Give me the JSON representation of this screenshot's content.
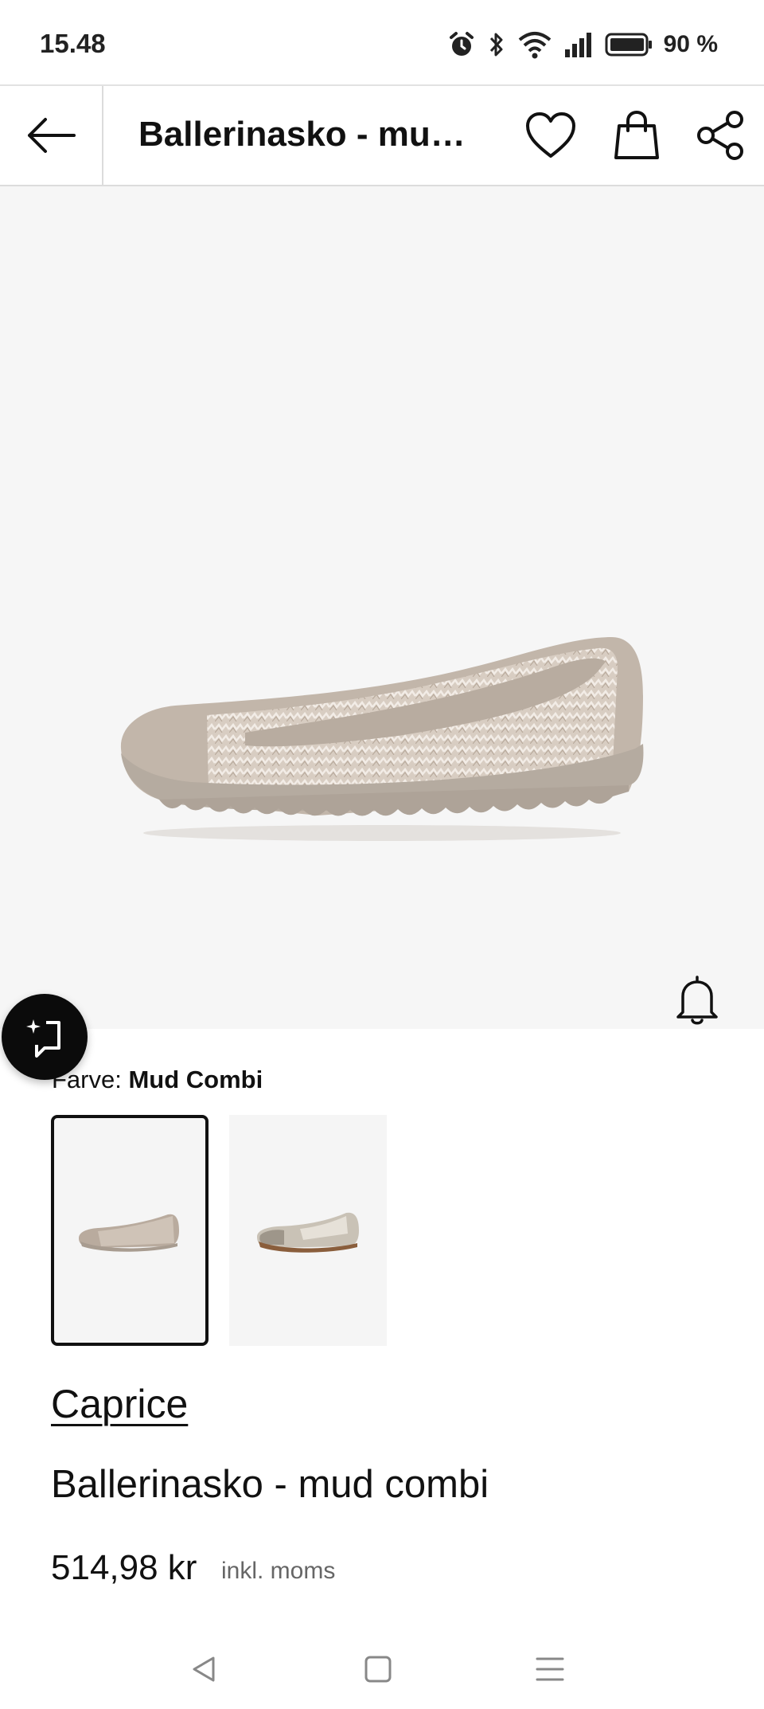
{
  "status_bar": {
    "time": "15.48",
    "battery": "90 %",
    "icons": [
      "alarm-icon",
      "bluetooth-icon",
      "wifi-icon",
      "signal-icon",
      "battery-icon"
    ]
  },
  "app_bar": {
    "title": "Ballerinasko - mud...",
    "icons": [
      "back-arrow-icon",
      "heart-icon",
      "shopping-bag-icon",
      "share-icon"
    ]
  },
  "product": {
    "color_label": "Farve: ",
    "color_value": "Mud Combi",
    "swatches": [
      {
        "name": "mud-combi",
        "selected": true
      },
      {
        "name": "metallic",
        "selected": false
      }
    ],
    "brand": "Caprice",
    "name": "Ballerinasko - mud combi",
    "price": "514,98 kr",
    "vat_note": "inkl. moms"
  },
  "fab": {
    "icon": "ai-sparkle-chat-icon"
  },
  "notify": {
    "icon": "bell-icon"
  },
  "nav_bar": {
    "icons": [
      "nav-back-icon",
      "nav-home-icon",
      "nav-menu-icon"
    ]
  },
  "colors": {
    "image_background": "#f6f6f6",
    "shoe_suede": "#c2b6aa",
    "shoe_sole": "#b5aba0",
    "text": "#111111",
    "muted_text": "#666666"
  }
}
